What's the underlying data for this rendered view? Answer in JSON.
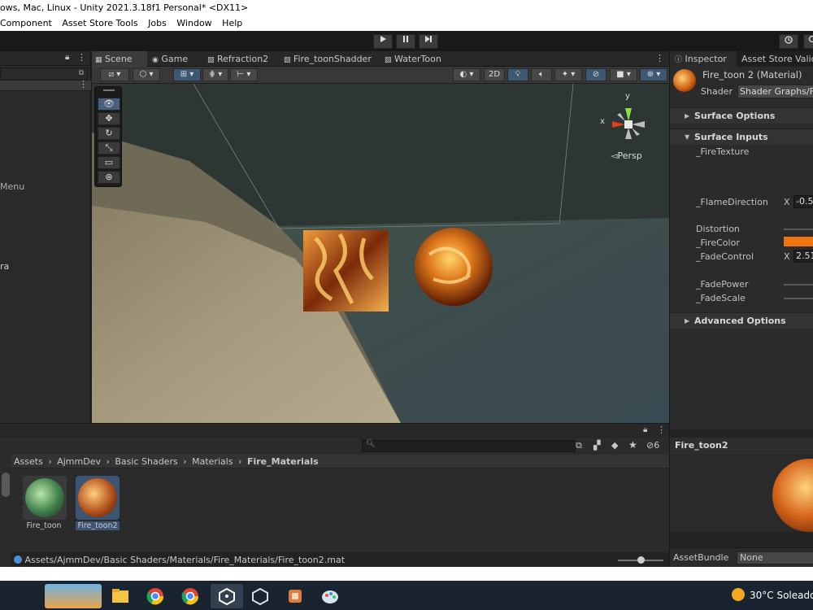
{
  "window": {
    "title": "ows, Mac, Linux - Unity 2021.3.18f1 Personal* <DX11>"
  },
  "menu": [
    "Component",
    "Asset Store Tools",
    "Jobs",
    "Window",
    "Help"
  ],
  "scene_tabs": [
    {
      "label": "Scene",
      "active": true,
      "icon": "grid-icon"
    },
    {
      "label": "Game",
      "active": false,
      "icon": "gamepad-icon"
    },
    {
      "label": "Refraction2",
      "active": false,
      "icon": "shader-graph-icon"
    },
    {
      "label": "Fire_toonShadder",
      "active": false,
      "icon": "shader-graph-icon"
    },
    {
      "label": "WaterToon",
      "active": false,
      "icon": "shader-graph-icon"
    }
  ],
  "scene_toolbar": {
    "mode_2d": "2D"
  },
  "hierarchy": {
    "fragment_menu": "Menu",
    "fragment_ra": "ra"
  },
  "gizmo": {
    "x_label": "x",
    "y_label": "y",
    "persp_label": "◅Persp"
  },
  "inspector": {
    "tab_inspector": "Inspector",
    "tab_asset_store": "Asset Store Valida",
    "material_name": "Fire_toon 2 (Material)",
    "shader_label": "Shader",
    "shader_value": "Shader Graphs/Fire",
    "surface_options": "Surface Options",
    "surface_inputs": "Surface Inputs",
    "fire_texture": "_FireTexture",
    "flame_direction": "_FlameDirection",
    "flame_x_label": "X",
    "flame_x_value": "-0.5",
    "distortion": "Distortion",
    "fire_color": "_FireColor",
    "fire_color_hex": "#f07410",
    "fade_control": "_FadeControl",
    "fade_x_label": "X",
    "fade_x_value": "2.51",
    "fade_power": "_FadePower",
    "fade_scale": "_FadeScale",
    "advanced_options": "Advanced Options"
  },
  "project": {
    "breadcrumb": [
      "Assets",
      "AjmmDev",
      "Basic Shaders",
      "Materials",
      "Fire_Materials"
    ],
    "hidden_count": "6",
    "assets": [
      {
        "name": "Fire_toon",
        "selected": false
      },
      {
        "name": "Fire_toon2",
        "selected": true
      }
    ],
    "status_path": "Assets/AjmmDev/Basic Shaders/Materials/Fire_Materials/Fire_toon2.mat"
  },
  "preview": {
    "title": "Fire_toon2",
    "assetbundle_label": "AssetBundle",
    "assetbundle_value": "None"
  },
  "taskbar": {
    "weather": "30°C  Soleado",
    "apps": [
      "widgets-icon",
      "file-explorer-icon",
      "chrome-icon",
      "chrome-alt-icon",
      "unity-hub-icon",
      "unity-icon",
      "blender-like-icon",
      "paint-icon"
    ]
  }
}
